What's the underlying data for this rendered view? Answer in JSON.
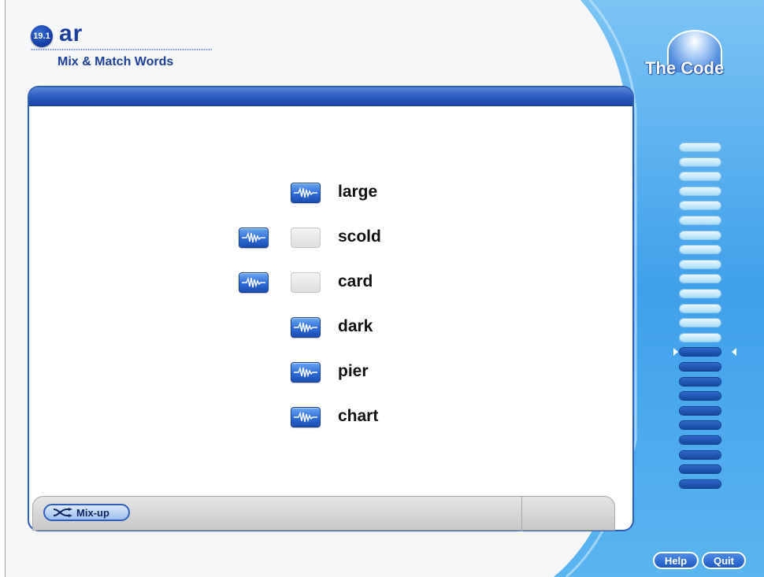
{
  "header": {
    "lesson_number": "19.1",
    "lesson_sound": "ar",
    "activity_title": "Mix & Match Words"
  },
  "brand": {
    "title": "The Code"
  },
  "words": [
    {
      "label": "large",
      "left_button": false,
      "slot": "filled"
    },
    {
      "label": "scold",
      "left_button": true,
      "slot": "empty"
    },
    {
      "label": "card",
      "left_button": true,
      "slot": "empty"
    },
    {
      "label": "dark",
      "left_button": false,
      "slot": "filled"
    },
    {
      "label": "pier",
      "left_button": false,
      "slot": "filled"
    },
    {
      "label": "chart",
      "left_button": false,
      "slot": "filled"
    }
  ],
  "toolbar": {
    "mixup_label": "Mix-up"
  },
  "footer": {
    "help_label": "Help",
    "quit_label": "Quit"
  },
  "progress": {
    "total_rungs": 24,
    "completed_rungs": 14
  },
  "colors": {
    "accent_blue": "#2f5fb8",
    "panel_blue": "#3fa0ea"
  },
  "icons": {
    "sound": "waveform-icon",
    "mix": "shuffle-icon"
  }
}
